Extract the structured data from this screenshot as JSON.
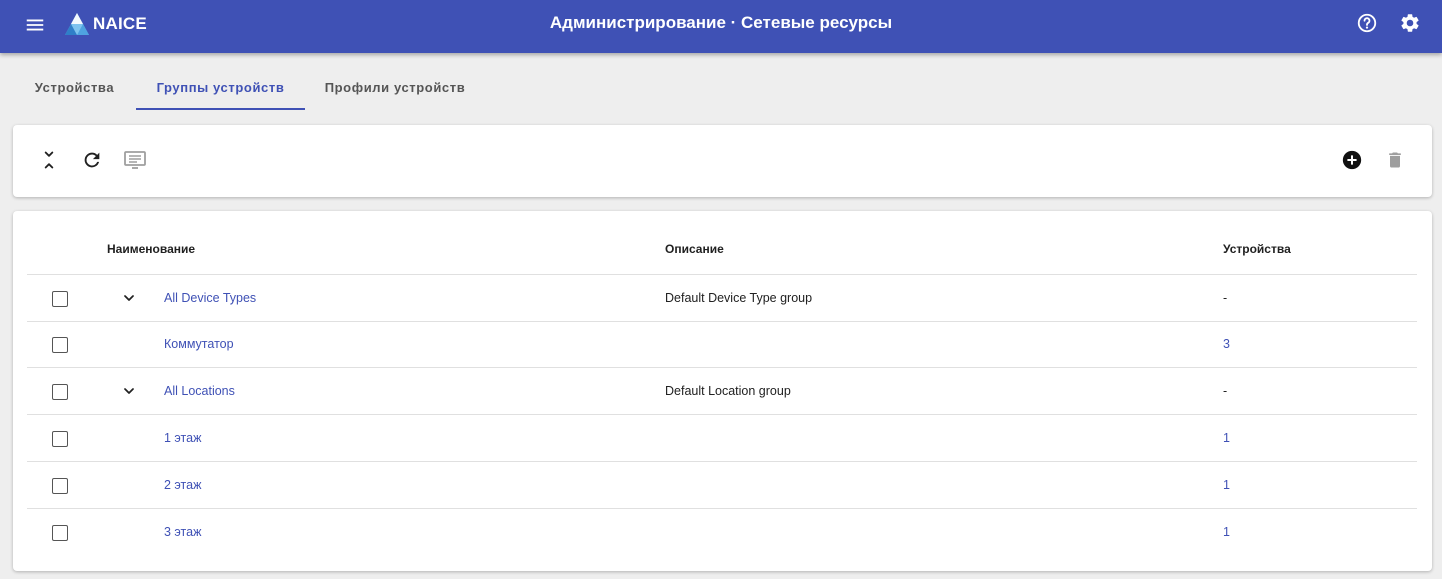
{
  "header": {
    "brand": "NAICE",
    "title": "Администрирование · Сетевые ресурсы",
    "color": "#3f51b5"
  },
  "tabs": [
    {
      "label": "Устройства",
      "active": false
    },
    {
      "label": "Группы устройств",
      "active": true
    },
    {
      "label": "Профили устройств",
      "active": false
    }
  ],
  "toolbar": {
    "left_icons": [
      "expand-collapse-icon",
      "refresh-icon",
      "list-view-icon"
    ],
    "right_icons": [
      "add-circle-icon",
      "delete-icon"
    ]
  },
  "table": {
    "columns": {
      "name": "Наименование",
      "description": "Описание",
      "devices": "Устройства"
    },
    "rows": [
      {
        "name": "All Device Types",
        "description": "Default Device Type group",
        "devices": "-",
        "expandable": true
      },
      {
        "name": "Коммутатор",
        "description": "",
        "devices": "3",
        "expandable": false
      },
      {
        "name": "All Locations",
        "description": "Default Location group",
        "devices": "-",
        "expandable": true
      },
      {
        "name": "1 этаж",
        "description": "",
        "devices": "1",
        "expandable": false
      },
      {
        "name": "2 этаж",
        "description": "",
        "devices": "1",
        "expandable": false
      },
      {
        "name": "3 этаж",
        "description": "",
        "devices": "1",
        "expandable": false
      }
    ]
  }
}
